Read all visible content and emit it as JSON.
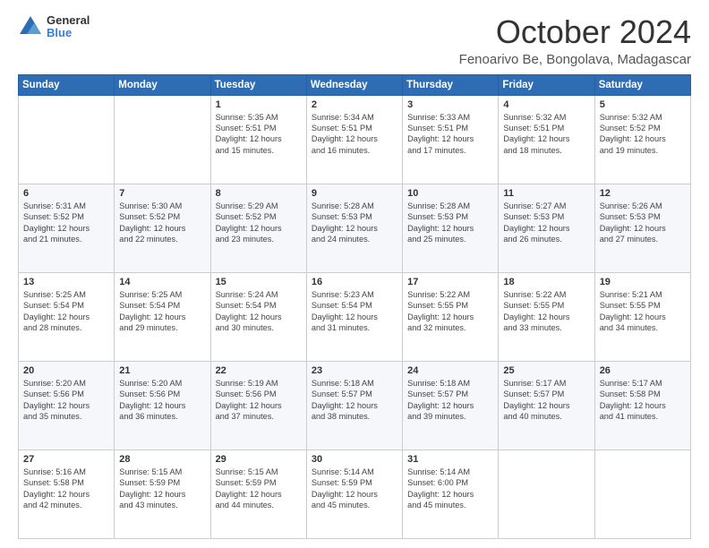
{
  "logo": {
    "general": "General",
    "blue": "Blue"
  },
  "header": {
    "month": "October 2024",
    "location": "Fenoarivo Be, Bongolava, Madagascar"
  },
  "days_of_week": [
    "Sunday",
    "Monday",
    "Tuesday",
    "Wednesday",
    "Thursday",
    "Friday",
    "Saturday"
  ],
  "weeks": [
    [
      {
        "day": "",
        "info": ""
      },
      {
        "day": "",
        "info": ""
      },
      {
        "day": "1",
        "info": "Sunrise: 5:35 AM\nSunset: 5:51 PM\nDaylight: 12 hours\nand 15 minutes."
      },
      {
        "day": "2",
        "info": "Sunrise: 5:34 AM\nSunset: 5:51 PM\nDaylight: 12 hours\nand 16 minutes."
      },
      {
        "day": "3",
        "info": "Sunrise: 5:33 AM\nSunset: 5:51 PM\nDaylight: 12 hours\nand 17 minutes."
      },
      {
        "day": "4",
        "info": "Sunrise: 5:32 AM\nSunset: 5:51 PM\nDaylight: 12 hours\nand 18 minutes."
      },
      {
        "day": "5",
        "info": "Sunrise: 5:32 AM\nSunset: 5:52 PM\nDaylight: 12 hours\nand 19 minutes."
      }
    ],
    [
      {
        "day": "6",
        "info": "Sunrise: 5:31 AM\nSunset: 5:52 PM\nDaylight: 12 hours\nand 21 minutes."
      },
      {
        "day": "7",
        "info": "Sunrise: 5:30 AM\nSunset: 5:52 PM\nDaylight: 12 hours\nand 22 minutes."
      },
      {
        "day": "8",
        "info": "Sunrise: 5:29 AM\nSunset: 5:52 PM\nDaylight: 12 hours\nand 23 minutes."
      },
      {
        "day": "9",
        "info": "Sunrise: 5:28 AM\nSunset: 5:53 PM\nDaylight: 12 hours\nand 24 minutes."
      },
      {
        "day": "10",
        "info": "Sunrise: 5:28 AM\nSunset: 5:53 PM\nDaylight: 12 hours\nand 25 minutes."
      },
      {
        "day": "11",
        "info": "Sunrise: 5:27 AM\nSunset: 5:53 PM\nDaylight: 12 hours\nand 26 minutes."
      },
      {
        "day": "12",
        "info": "Sunrise: 5:26 AM\nSunset: 5:53 PM\nDaylight: 12 hours\nand 27 minutes."
      }
    ],
    [
      {
        "day": "13",
        "info": "Sunrise: 5:25 AM\nSunset: 5:54 PM\nDaylight: 12 hours\nand 28 minutes."
      },
      {
        "day": "14",
        "info": "Sunrise: 5:25 AM\nSunset: 5:54 PM\nDaylight: 12 hours\nand 29 minutes."
      },
      {
        "day": "15",
        "info": "Sunrise: 5:24 AM\nSunset: 5:54 PM\nDaylight: 12 hours\nand 30 minutes."
      },
      {
        "day": "16",
        "info": "Sunrise: 5:23 AM\nSunset: 5:54 PM\nDaylight: 12 hours\nand 31 minutes."
      },
      {
        "day": "17",
        "info": "Sunrise: 5:22 AM\nSunset: 5:55 PM\nDaylight: 12 hours\nand 32 minutes."
      },
      {
        "day": "18",
        "info": "Sunrise: 5:22 AM\nSunset: 5:55 PM\nDaylight: 12 hours\nand 33 minutes."
      },
      {
        "day": "19",
        "info": "Sunrise: 5:21 AM\nSunset: 5:55 PM\nDaylight: 12 hours\nand 34 minutes."
      }
    ],
    [
      {
        "day": "20",
        "info": "Sunrise: 5:20 AM\nSunset: 5:56 PM\nDaylight: 12 hours\nand 35 minutes."
      },
      {
        "day": "21",
        "info": "Sunrise: 5:20 AM\nSunset: 5:56 PM\nDaylight: 12 hours\nand 36 minutes."
      },
      {
        "day": "22",
        "info": "Sunrise: 5:19 AM\nSunset: 5:56 PM\nDaylight: 12 hours\nand 37 minutes."
      },
      {
        "day": "23",
        "info": "Sunrise: 5:18 AM\nSunset: 5:57 PM\nDaylight: 12 hours\nand 38 minutes."
      },
      {
        "day": "24",
        "info": "Sunrise: 5:18 AM\nSunset: 5:57 PM\nDaylight: 12 hours\nand 39 minutes."
      },
      {
        "day": "25",
        "info": "Sunrise: 5:17 AM\nSunset: 5:57 PM\nDaylight: 12 hours\nand 40 minutes."
      },
      {
        "day": "26",
        "info": "Sunrise: 5:17 AM\nSunset: 5:58 PM\nDaylight: 12 hours\nand 41 minutes."
      }
    ],
    [
      {
        "day": "27",
        "info": "Sunrise: 5:16 AM\nSunset: 5:58 PM\nDaylight: 12 hours\nand 42 minutes."
      },
      {
        "day": "28",
        "info": "Sunrise: 5:15 AM\nSunset: 5:59 PM\nDaylight: 12 hours\nand 43 minutes."
      },
      {
        "day": "29",
        "info": "Sunrise: 5:15 AM\nSunset: 5:59 PM\nDaylight: 12 hours\nand 44 minutes."
      },
      {
        "day": "30",
        "info": "Sunrise: 5:14 AM\nSunset: 5:59 PM\nDaylight: 12 hours\nand 45 minutes."
      },
      {
        "day": "31",
        "info": "Sunrise: 5:14 AM\nSunset: 6:00 PM\nDaylight: 12 hours\nand 45 minutes."
      },
      {
        "day": "",
        "info": ""
      },
      {
        "day": "",
        "info": ""
      }
    ]
  ]
}
